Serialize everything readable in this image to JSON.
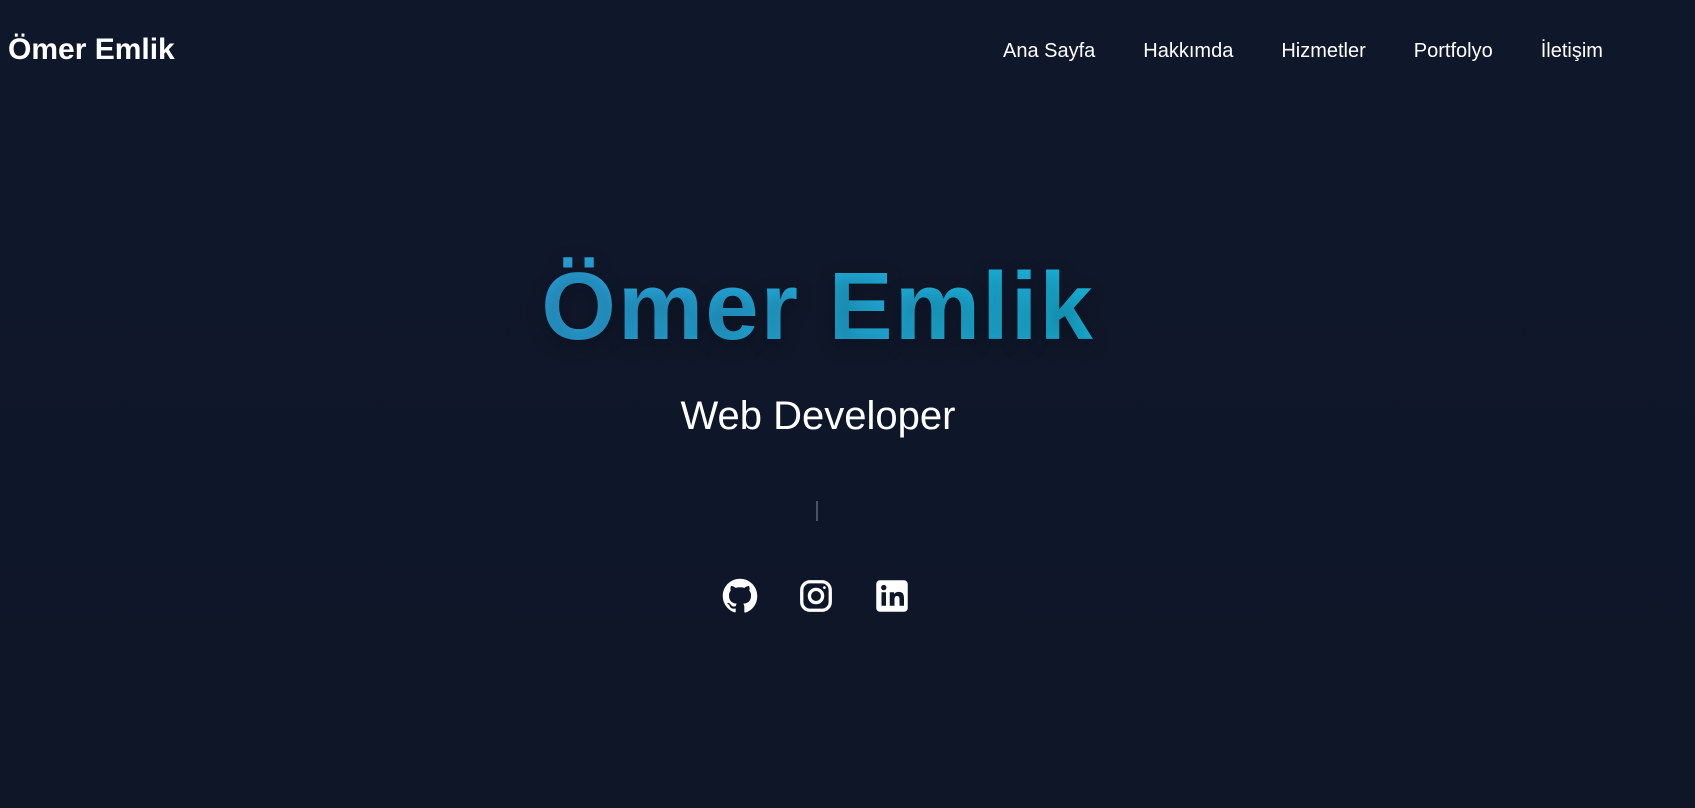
{
  "header": {
    "brand": "Ömer Emlik",
    "nav": [
      {
        "label": "Ana Sayfa"
      },
      {
        "label": "Hakkımda"
      },
      {
        "label": "Hizmetler"
      },
      {
        "label": "Portfolyo"
      },
      {
        "label": "İletişim"
      }
    ]
  },
  "hero": {
    "title": "Ömer Emlik",
    "subtitle": "Web Developer"
  },
  "socials": [
    {
      "icon": "github-icon"
    },
    {
      "icon": "instagram-icon"
    },
    {
      "icon": "linkedin-icon"
    }
  ],
  "colors": {
    "background": "#0f172a",
    "title_gradient_start": "#3b8ed8",
    "title_gradient_end": "#06c4d8",
    "text": "#ffffff"
  }
}
